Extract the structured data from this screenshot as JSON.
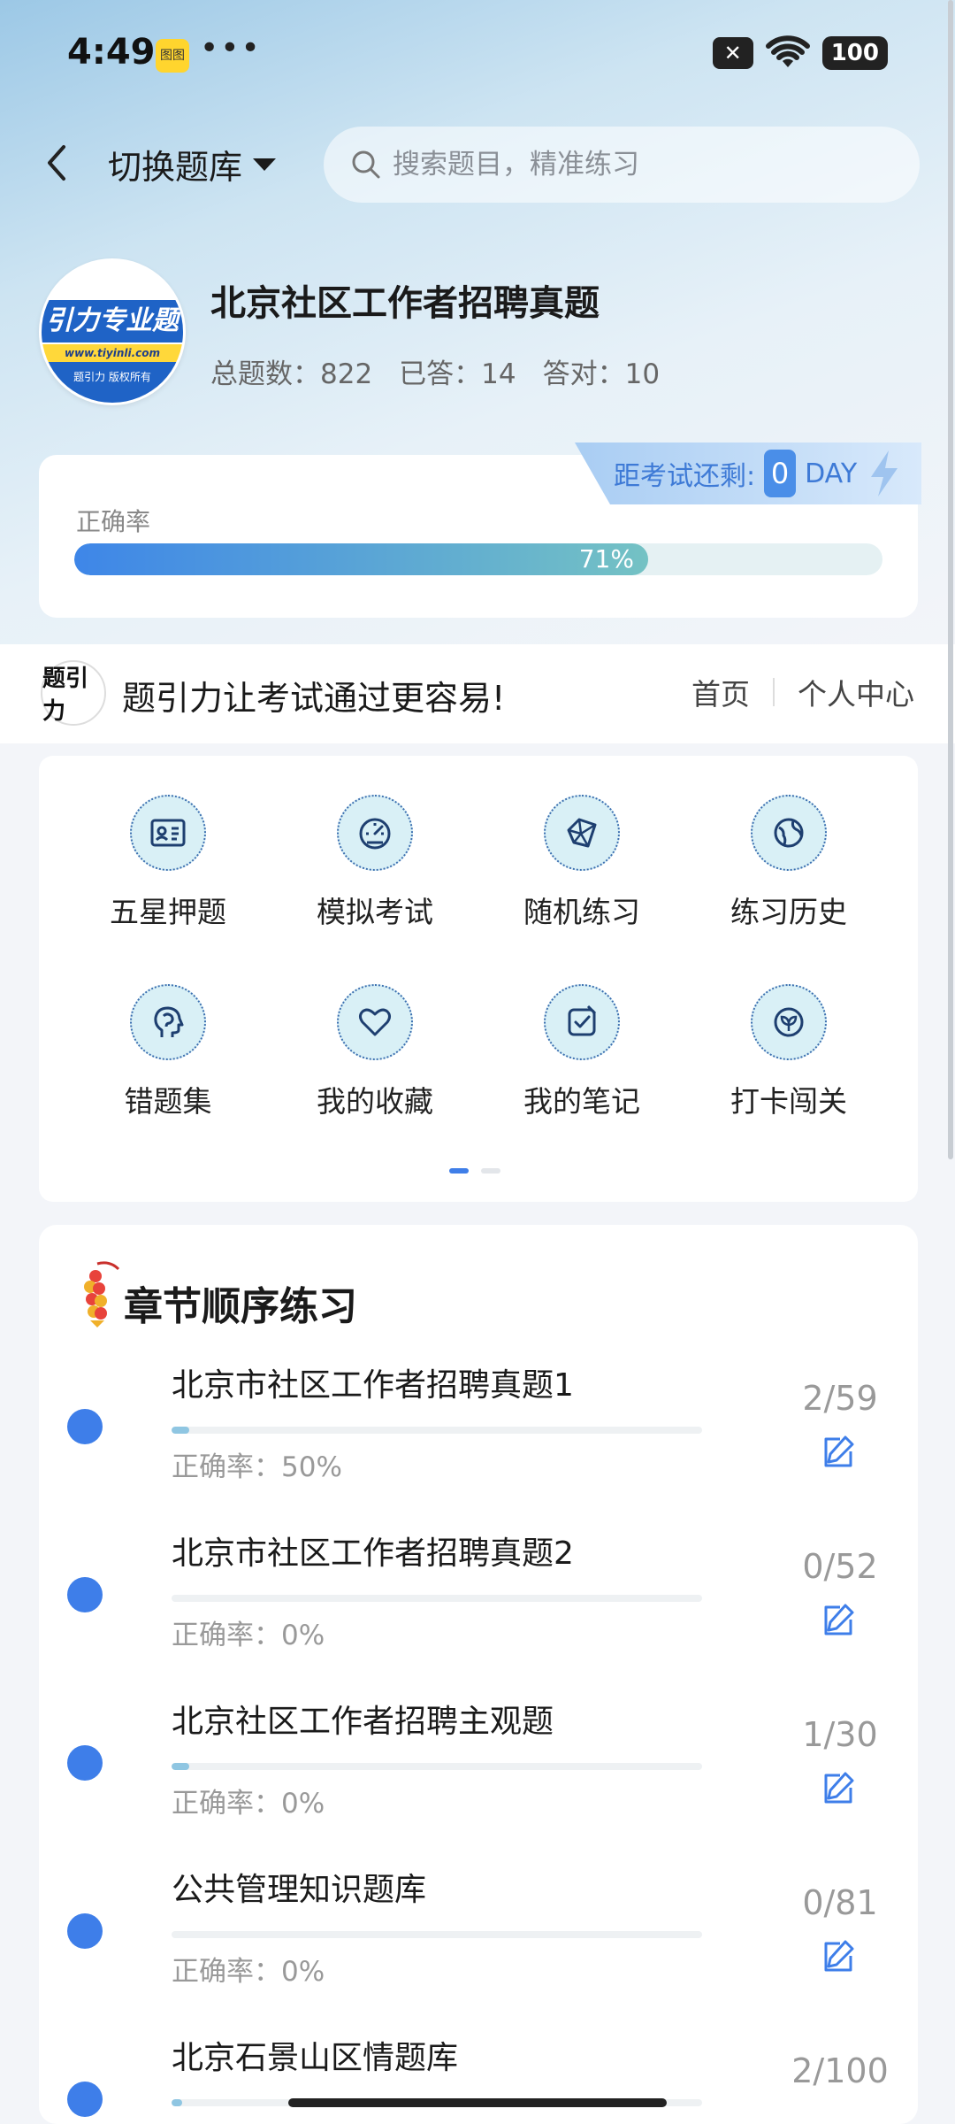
{
  "status_bar": {
    "time": "4:49",
    "app_badge": "图图",
    "more": "•••",
    "sim": "✕",
    "battery": "100"
  },
  "header": {
    "switch_label": "切换题库",
    "search_placeholder": "搜索题目，精准练习"
  },
  "bank": {
    "logo_text": "引力专业题",
    "logo_url": "www.tiyinli.com",
    "logo_caption": "题引力 版权所有",
    "logo_top": "题引力",
    "title": "北京社区工作者招聘真题",
    "total_label": "总题数：",
    "total_value": "822",
    "answered_label": "已答：",
    "answered_value": "14",
    "correct_label": "答对：",
    "correct_value": "10"
  },
  "exam": {
    "label": "距考试还剩:",
    "days": "0",
    "unit": "DAY"
  },
  "accuracy": {
    "label": "正确率",
    "percent_text": "71%",
    "value": 0.71
  },
  "slogan": {
    "logo": "题引力",
    "text": "题引力让考试通过更容易!",
    "nav_home": "首页",
    "nav_profile": "个人中心"
  },
  "features": [
    {
      "label": "五星押题",
      "icon": "id-card-icon"
    },
    {
      "label": "模拟考试",
      "icon": "speedometer-icon"
    },
    {
      "label": "随机练习",
      "icon": "random-network-icon"
    },
    {
      "label": "练习历史",
      "icon": "globe-history-icon"
    },
    {
      "label": "错题集",
      "icon": "head-brain-icon"
    },
    {
      "label": "我的收藏",
      "icon": "heart-icon"
    },
    {
      "label": "我的笔记",
      "icon": "checked-note-icon"
    },
    {
      "label": "打卡闯关",
      "icon": "leaf-badge-icon"
    }
  ],
  "pager": {
    "pages": 2,
    "active": 0
  },
  "chapters_section": {
    "title": "章节顺序练习",
    "acc_label": "正确率：",
    "items": [
      {
        "name": "北京市社区工作者招聘真题1",
        "accuracy": "50%",
        "count": "2/59",
        "progress": 0.034
      },
      {
        "name": "北京市社区工作者招聘真题2",
        "accuracy": "0%",
        "count": "0/52",
        "progress": 0
      },
      {
        "name": "北京社区工作者招聘主观题",
        "accuracy": "0%",
        "count": "1/30",
        "progress": 0.033
      },
      {
        "name": "公共管理知识题库",
        "accuracy": "0%",
        "count": "0/81",
        "progress": 0
      },
      {
        "name": "北京石景山区情题库",
        "accuracy": "",
        "count": "2/100",
        "progress": 0.02
      }
    ]
  },
  "colors": {
    "accent": "#3e7ee9",
    "progress_end": "#74c2c4",
    "tag_text": "#3e7ad6"
  }
}
